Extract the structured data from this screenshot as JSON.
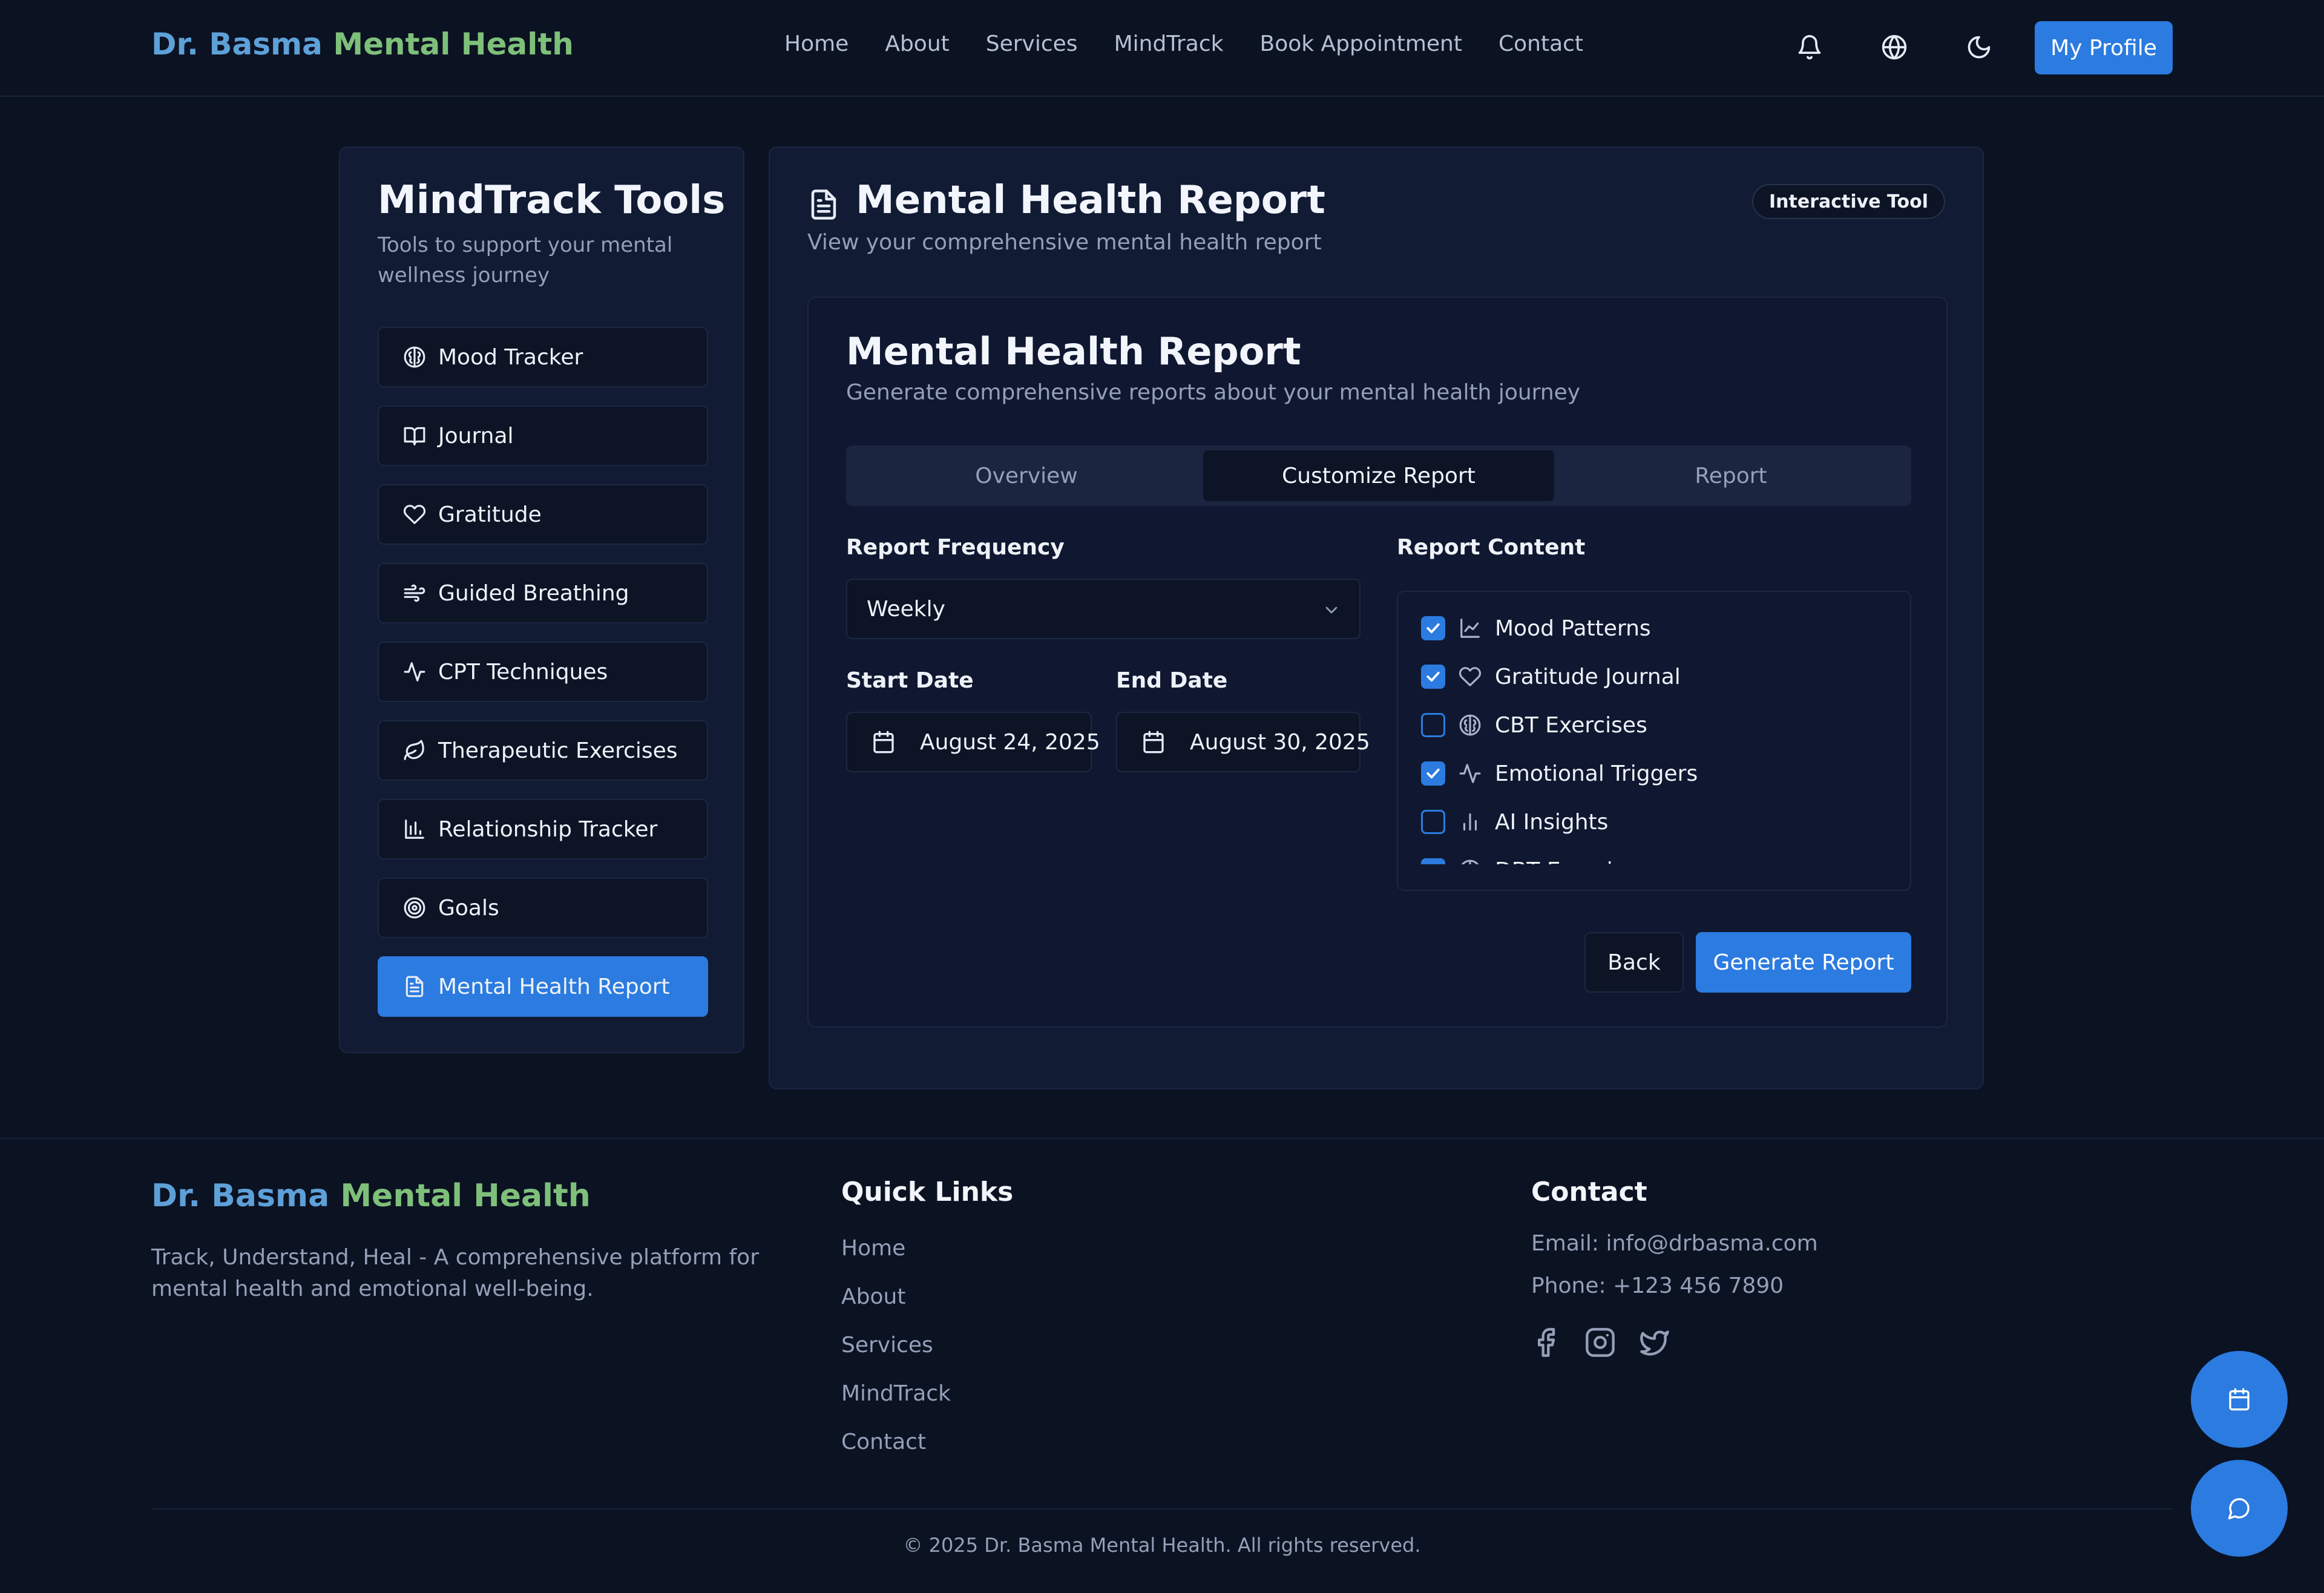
{
  "header": {
    "brand_part1": "Dr. Basma",
    "brand_part2": "Mental Health",
    "nav": [
      "Home",
      "About",
      "Services",
      "MindTrack",
      "Book Appointment",
      "Contact"
    ],
    "icons": [
      "bell-icon",
      "globe-icon",
      "moon-icon"
    ],
    "profile_label": "My Profile"
  },
  "sidebar": {
    "title": "MindTrack Tools",
    "subtitle": "Tools to support your mental wellness journey",
    "items": [
      {
        "label": "Mood Tracker",
        "icon": "brain-icon"
      },
      {
        "label": "Journal",
        "icon": "book-icon"
      },
      {
        "label": "Gratitude",
        "icon": "heart-icon"
      },
      {
        "label": "Guided Breathing",
        "icon": "wind-icon"
      },
      {
        "label": "CPT Techniques",
        "icon": "activity-icon"
      },
      {
        "label": "Therapeutic Exercises",
        "icon": "leaf-icon"
      },
      {
        "label": "Relationship Tracker",
        "icon": "bar-chart-icon"
      },
      {
        "label": "Goals",
        "icon": "target-icon"
      },
      {
        "label": "Mental Health Report",
        "icon": "file-text-icon",
        "active": true
      }
    ]
  },
  "main": {
    "title": "Mental Health Report",
    "subtitle": "View your comprehensive mental health report",
    "badge": "Interactive Tool",
    "card": {
      "title": "Mental Health Report",
      "subtitle": "Generate comprehensive reports about your mental health journey",
      "tabs": [
        {
          "label": "Overview",
          "active": false
        },
        {
          "label": "Customize Report",
          "active": true
        },
        {
          "label": "Report",
          "active": false
        }
      ],
      "frequency_label": "Report Frequency",
      "frequency_value": "Weekly",
      "start_label": "Start Date",
      "start_value": "August 24, 2025",
      "end_label": "End Date",
      "end_value": "August 30, 2025",
      "content_label": "Report Content",
      "content_items": [
        {
          "label": "Mood Patterns",
          "checked": true,
          "icon": "line-chart-icon"
        },
        {
          "label": "Gratitude Journal",
          "checked": true,
          "icon": "heart-icon"
        },
        {
          "label": "CBT Exercises",
          "checked": false,
          "icon": "brain-icon"
        },
        {
          "label": "Emotional Triggers",
          "checked": true,
          "icon": "activity-icon"
        },
        {
          "label": "AI Insights",
          "checked": false,
          "icon": "bar-chart-icon"
        },
        {
          "label": "DBT Exercises",
          "checked": true,
          "icon": "brain-icon"
        }
      ],
      "back_label": "Back",
      "generate_label": "Generate Report"
    }
  },
  "footer": {
    "brand_part1": "Dr. Basma",
    "brand_part2": "Mental Health",
    "description": "Track, Understand, Heal - A comprehensive platform for mental health and emotional well-being.",
    "quick_links_title": "Quick Links",
    "quick_links": [
      "Home",
      "About",
      "Services",
      "MindTrack",
      "Contact"
    ],
    "contact_title": "Contact",
    "email": "Email: info@drbasma.com",
    "phone": "Phone: +123 456 7890",
    "social": [
      "facebook-icon",
      "instagram-icon",
      "twitter-icon"
    ],
    "copyright": "© 2025 Dr. Basma Mental Health. All rights reserved."
  },
  "fabs": [
    "calendar-icon",
    "chat-icon"
  ],
  "colors": {
    "background": "#0b1222",
    "panel": "#111b33",
    "accent": "#2b7be0",
    "brand_blue": "#5ea0d8",
    "brand_green": "#7ec07a"
  }
}
